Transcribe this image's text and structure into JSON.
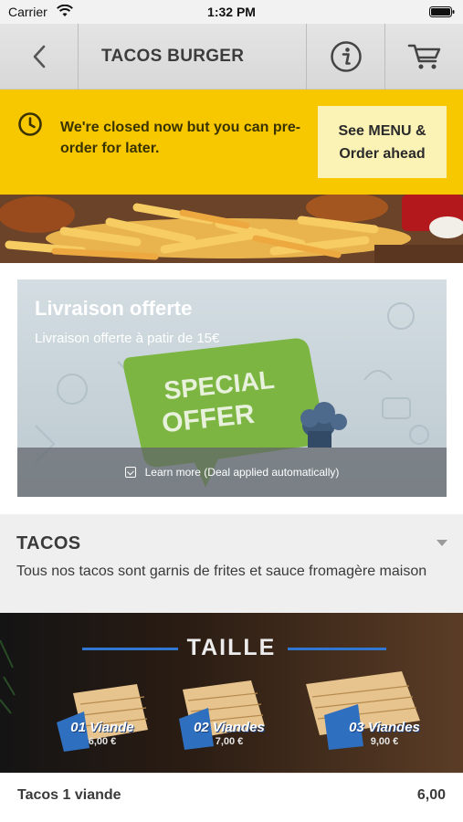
{
  "status_bar": {
    "carrier": "Carrier",
    "time": "1:32 PM"
  },
  "nav": {
    "title": "TACOS BURGER",
    "icons": {
      "back": "chevron-left-icon",
      "info": "info-circle-icon",
      "cart": "shopping-cart-icon"
    }
  },
  "closed_banner": {
    "message": "We're closed now but you can pre-order for later.",
    "button_line1": "See MENU &",
    "button_line2": "Order ahead",
    "background_color": "#f7c800"
  },
  "offer": {
    "title": "Livraison offerte",
    "subtitle": "Livraison offerte à patir de 15€",
    "badge_line1": "SPECIAL",
    "badge_line2": "OFFER",
    "footer": "Learn more (Deal applied automatically)"
  },
  "section": {
    "title": "TACOS",
    "description": "Tous nos tacos sont garnis de frites et sauce fromagère maison"
  },
  "taille_banner": {
    "title": "TAILLE",
    "sizes": [
      {
        "name": "01 Viande",
        "price": "6,00 €"
      },
      {
        "name": "02 Viandes",
        "price": "7,00 €"
      },
      {
        "name": "03 Viandes",
        "price": "9,00 €"
      }
    ]
  },
  "products": [
    {
      "name": "Tacos 1 viande",
      "price": "6,00"
    }
  ],
  "colors": {
    "accent_yellow": "#f7c800",
    "banner_blue": "#2f77d0",
    "offer_green": "#7cb542"
  }
}
